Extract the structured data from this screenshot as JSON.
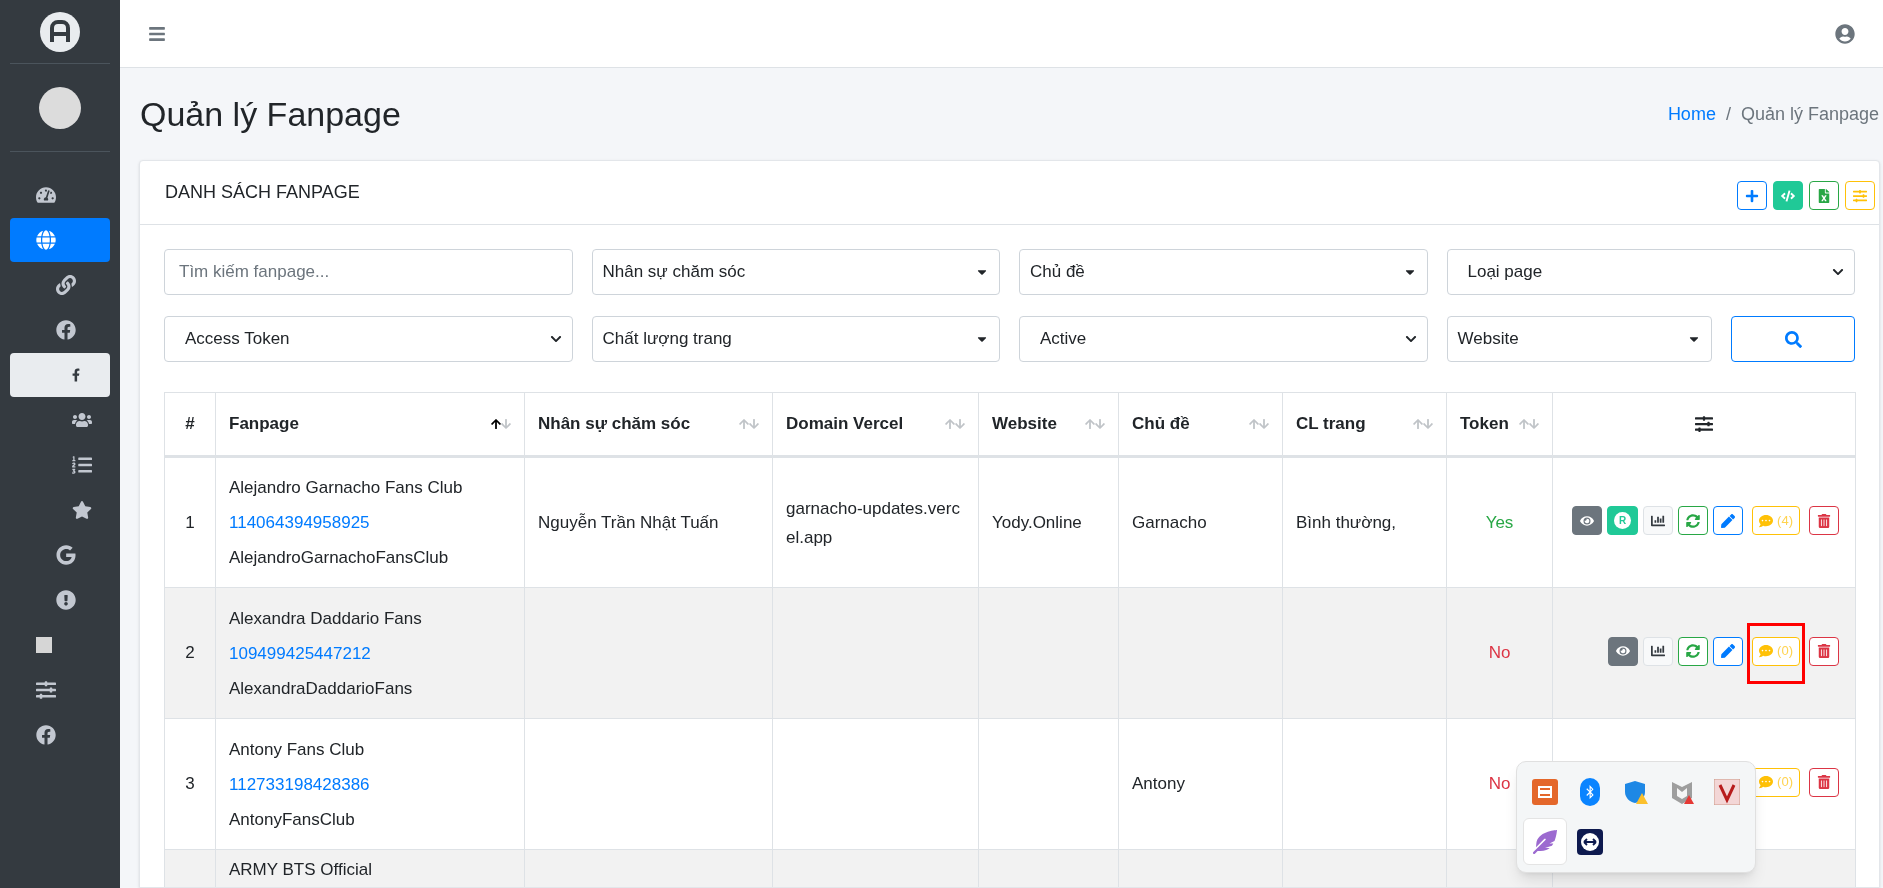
{
  "sidebar": {
    "items": [
      {
        "selected": false,
        "hovered": false
      },
      {
        "selected": true,
        "hovered": false,
        "children": [
          {
            "selected": false,
            "hovered": false
          },
          {
            "selected": false,
            "hovered": false,
            "children": [
              {
                "selected": false,
                "hovered": true
              },
              {
                "selected": false,
                "hovered": false
              },
              {
                "selected": false,
                "hovered": false
              },
              {
                "selected": false,
                "hovered": false
              }
            ]
          },
          {
            "selected": false,
            "hovered": false
          },
          {
            "selected": false,
            "hovered": false
          }
        ]
      },
      {
        "selected": false,
        "hovered": false
      },
      {
        "selected": false,
        "hovered": false
      },
      {
        "selected": false,
        "hovered": false
      }
    ]
  },
  "page": {
    "title": "Quản lý Fanpage",
    "breadcrumb": [
      {
        "label": "Home",
        "kind": "link"
      },
      {
        "label": "/",
        "kind": "separator"
      },
      {
        "label": "Quản lý Fanpage",
        "kind": "current"
      }
    ]
  },
  "card": {
    "title": "DANH SÁCH FANPAGE",
    "toolbar": [
      {
        "kind": "add"
      },
      {
        "kind": "code"
      },
      {
        "kind": "excel"
      },
      {
        "kind": "settings"
      }
    ]
  },
  "filters": [
    {
      "kind": "search",
      "placeholder": "Tìm kiếm fanpage..."
    },
    {
      "kind": "select2",
      "value": "Nhân sự chăm sóc"
    },
    {
      "kind": "select2",
      "value": "Chủ đề"
    },
    {
      "kind": "native",
      "value": "Loại page"
    },
    {
      "kind": "native",
      "value": "Access Token"
    },
    {
      "kind": "select2",
      "value": "Chất lượng trang"
    },
    {
      "kind": "native",
      "value": "Active"
    },
    {
      "kind": "select2",
      "value": "Website"
    }
  ],
  "table": {
    "columns": [
      {
        "label": "#",
        "sortable": false
      },
      {
        "label": "Fanpage",
        "sortable": true,
        "sorted": true
      },
      {
        "label": "Nhân sự chăm sóc",
        "sortable": true,
        "sorted": false
      },
      {
        "label": "Domain Vercel",
        "sortable": true,
        "sorted": false
      },
      {
        "label": "Website",
        "sortable": true,
        "sorted": false
      },
      {
        "label": "Chủ đề",
        "sortable": true,
        "sorted": false
      },
      {
        "label": "CL trang",
        "sortable": true,
        "sorted": false
      },
      {
        "label": "Token",
        "sortable": true,
        "sorted": false
      }
    ],
    "rows": [
      {
        "index": "1",
        "name": "Alejandro Garnacho Fans Club",
        "page_id": "114064394958925",
        "slug": "AlejandroGarnachoFansClub",
        "staff": "Nguyễn Trần Nhật Tuấn",
        "domain": "garnacho-updates.vercel.app",
        "website": "Yody.Online",
        "topic": "Garnacho",
        "quality": "Bình thường,",
        "token": "Yes",
        "token_ok": true,
        "actions": [
          {
            "kind": "view"
          },
          {
            "kind": "r",
            "label": "R"
          },
          {
            "kind": "chart"
          },
          {
            "kind": "refresh"
          },
          {
            "kind": "edit"
          },
          {
            "kind": "comments",
            "label": "(4)",
            "highlighted": false
          },
          {
            "kind": "delete"
          }
        ]
      },
      {
        "index": "2",
        "name": "Alexandra Daddario Fans",
        "page_id": "109499425447212",
        "slug": "AlexandraDaddarioFans",
        "staff": "",
        "domain": "",
        "website": "",
        "topic": "",
        "quality": "",
        "token": "No",
        "token_ok": false,
        "actions": [
          {
            "kind": "view"
          },
          {
            "kind": "chart"
          },
          {
            "kind": "refresh"
          },
          {
            "kind": "edit"
          },
          {
            "kind": "comments",
            "label": "(0)",
            "highlighted": true
          },
          {
            "kind": "delete"
          }
        ]
      },
      {
        "index": "3",
        "name": "Antony Fans Club",
        "page_id": "112733198428386",
        "slug": "AntonyFansClub",
        "staff": "",
        "domain": "",
        "website": "",
        "topic": "Antony",
        "quality": "",
        "token": "No",
        "token_ok": false,
        "actions": [
          {
            "kind": "comments",
            "label": "(0)",
            "highlighted": false
          },
          {
            "kind": "delete"
          }
        ]
      },
      {
        "index": "",
        "name": "ARMY BTS Official",
        "page_id": "",
        "slug": "",
        "staff": "",
        "domain": "",
        "website": "",
        "topic": "",
        "quality": "",
        "token": "",
        "actions": []
      }
    ]
  },
  "tray_popup": {
    "icons": [
      {
        "kind": "xampp",
        "hovered": false
      },
      {
        "kind": "bluetooth",
        "hovered": false
      },
      {
        "kind": "defender",
        "hovered": false
      },
      {
        "kind": "mcafee",
        "hovered": false
      },
      {
        "kind": "vlogo",
        "hovered": false
      },
      {
        "kind": "feather",
        "hovered": true
      },
      {
        "kind": "teamviewer",
        "hovered": false
      }
    ]
  }
}
